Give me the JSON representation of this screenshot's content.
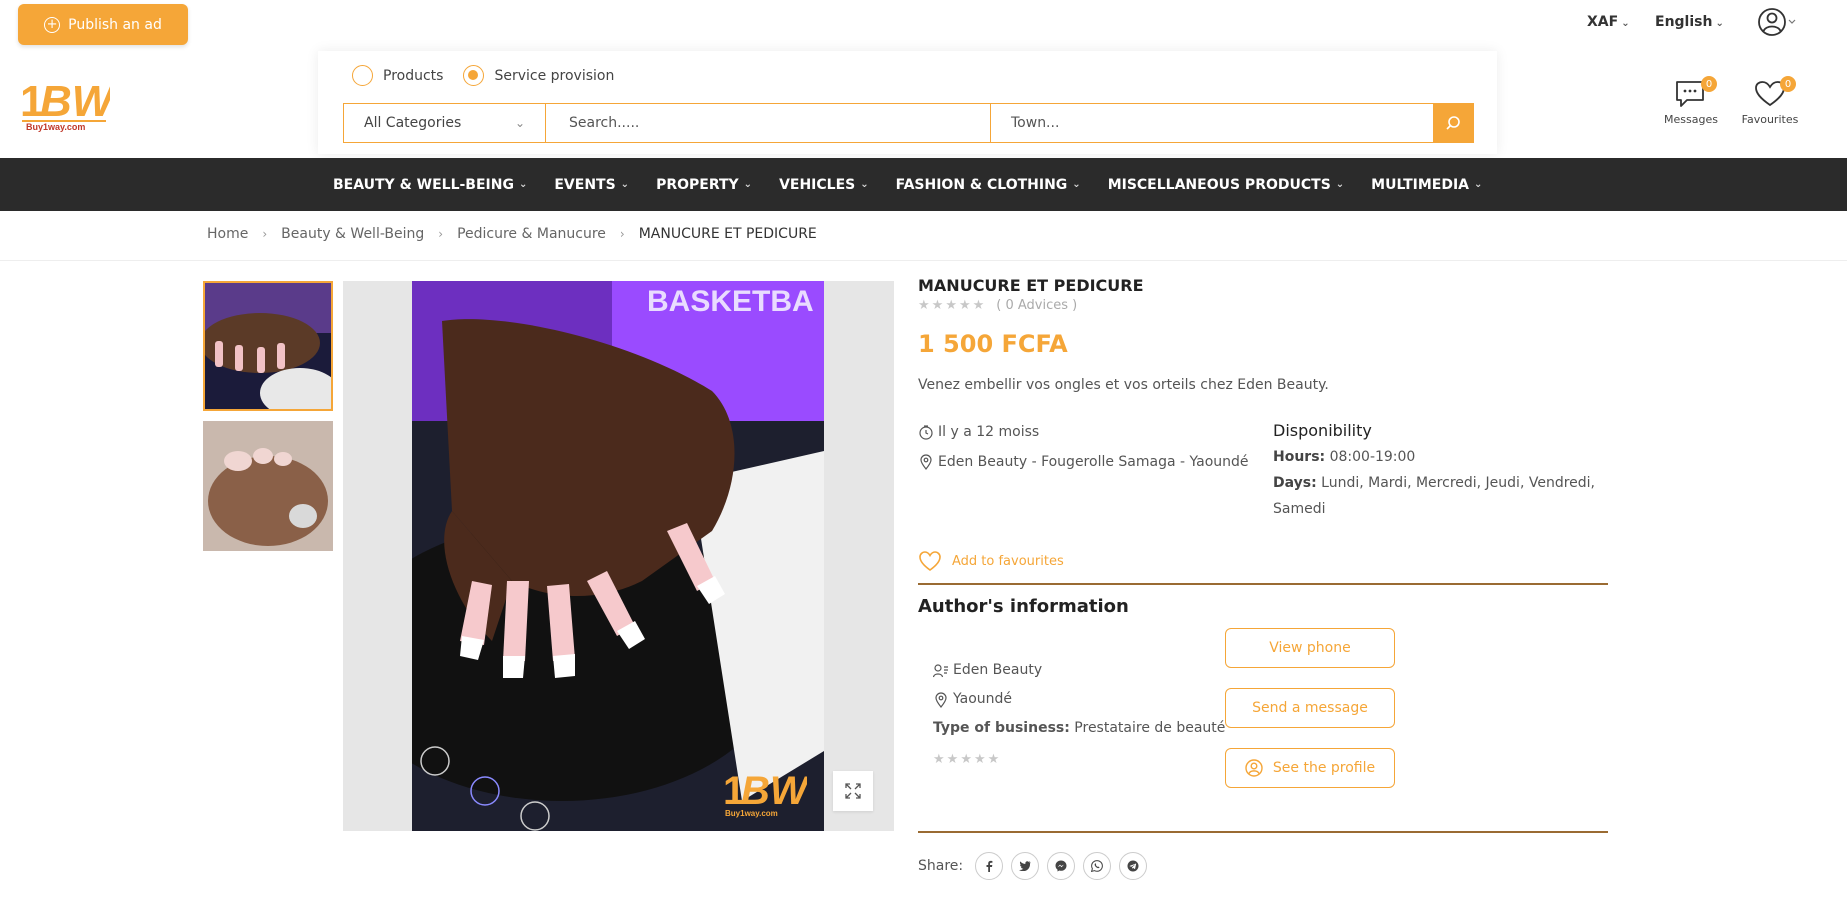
{
  "top_bar": {
    "publish_label": "Publish an ad",
    "currency": "XAF",
    "language": "English"
  },
  "logo": {
    "text_main": "1BW",
    "text_sub": "Buy1way.com"
  },
  "search": {
    "radio_products": "Products",
    "radio_services": "Service provision",
    "selected": "Service provision",
    "category_value": "All Categories",
    "search_placeholder": "Search.....",
    "town_placeholder": "Town..."
  },
  "header_icons": {
    "messages_label": "Messages",
    "messages_count": "0",
    "favourites_label": "Favourites",
    "favourites_count": "0"
  },
  "nav": {
    "items": [
      "BEAUTY & WELL-BEING",
      "EVENTS",
      "PROPERTY",
      "VEHICLES",
      "FASHION & CLOTHING",
      "MISCELLANEOUS PRODUCTS",
      "MULTIMEDIA"
    ]
  },
  "breadcrumb": [
    "Home",
    "Beauty & Well-Being",
    "Pedicure & Manucure",
    "MANUCURE ET PEDICURE"
  ],
  "listing": {
    "title": "MANUCURE ET PEDICURE",
    "advices": "( 0 Advices )",
    "rating": 0,
    "price": "1 500 FCFA",
    "description": "Venez embellir vos ongles et vos orteils chez Eden Beauty.",
    "posted": "Il y a 12 moiss",
    "location": "Eden Beauty - Fougerolle Samaga - Yaoundé",
    "disponibility_title": "Disponibility",
    "hours_label": "Hours:",
    "hours_value": "08:00-19:00",
    "days_label": "Days:",
    "days_value": "Lundi, Mardi, Mercredi, Jeudi, Vendredi, Samedi",
    "add_fav": "Add to favourites"
  },
  "author": {
    "section_title": "Author's information",
    "name": "Eden Beauty",
    "city": "Yaoundé",
    "business_label": "Type of business:",
    "business_value": "Prestataire de beauté",
    "rating": 0,
    "view_phone": "View phone",
    "send_message": "Send a message",
    "see_profile": "See the profile"
  },
  "share": {
    "label": "Share:"
  },
  "colors": {
    "accent": "#f5a638",
    "nav_bg": "#2b2b2b",
    "divider": "#9a6b32"
  }
}
